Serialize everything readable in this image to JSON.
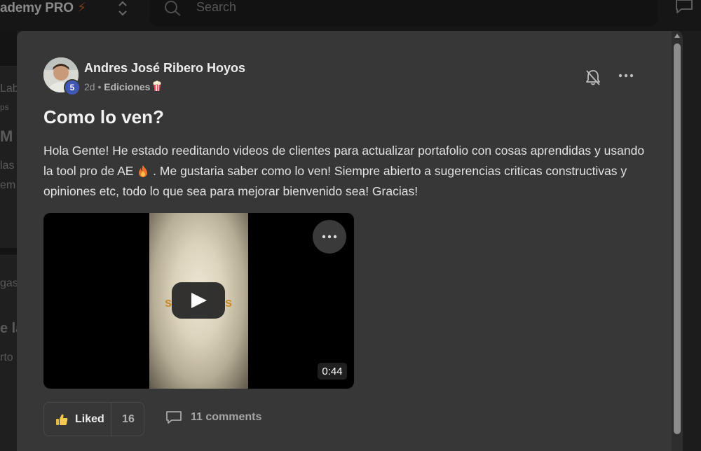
{
  "app": {
    "brand": "ademy PRO",
    "search_placeholder": "Search"
  },
  "background_fragments": [
    "Lab",
    "ps",
    "M",
    "las",
    "em",
    "gas",
    "e la",
    "rto"
  ],
  "post": {
    "author": "Andres José Ribero Hoyos",
    "level": "5",
    "time": "2d",
    "separator": "•",
    "category": "Ediciones",
    "title": "Como lo ven?",
    "body_part1": "Hola Gente! He estado reeditando videos de clientes para actualizar portafolio con cosas aprendidas y usando la tool pro de AE",
    "body_part2": ". Me gustaria saber como lo ven! Siempre abierto a sugerencias criticas constructivas y opiniones etc, todo lo que sea para mejorar bienvenido sea! Gracias!",
    "video": {
      "duration": "0:44",
      "overlay_left": "s",
      "overlay_right": "s"
    },
    "reactions": {
      "like_label": "Liked",
      "like_count": "16",
      "comments_label": "11 comments"
    }
  },
  "icons": [
    "bolt-icon",
    "switch-icon",
    "search-icon",
    "chat-icon",
    "bell-off-icon",
    "more-icon",
    "popcorn-icon",
    "fire-icon",
    "play-icon",
    "thumbs-up-icon",
    "comment-icon"
  ],
  "colors": {
    "modal_bg": "#373737",
    "level_badge": "#3f57b5",
    "page_bg": "#1c1c1c"
  }
}
